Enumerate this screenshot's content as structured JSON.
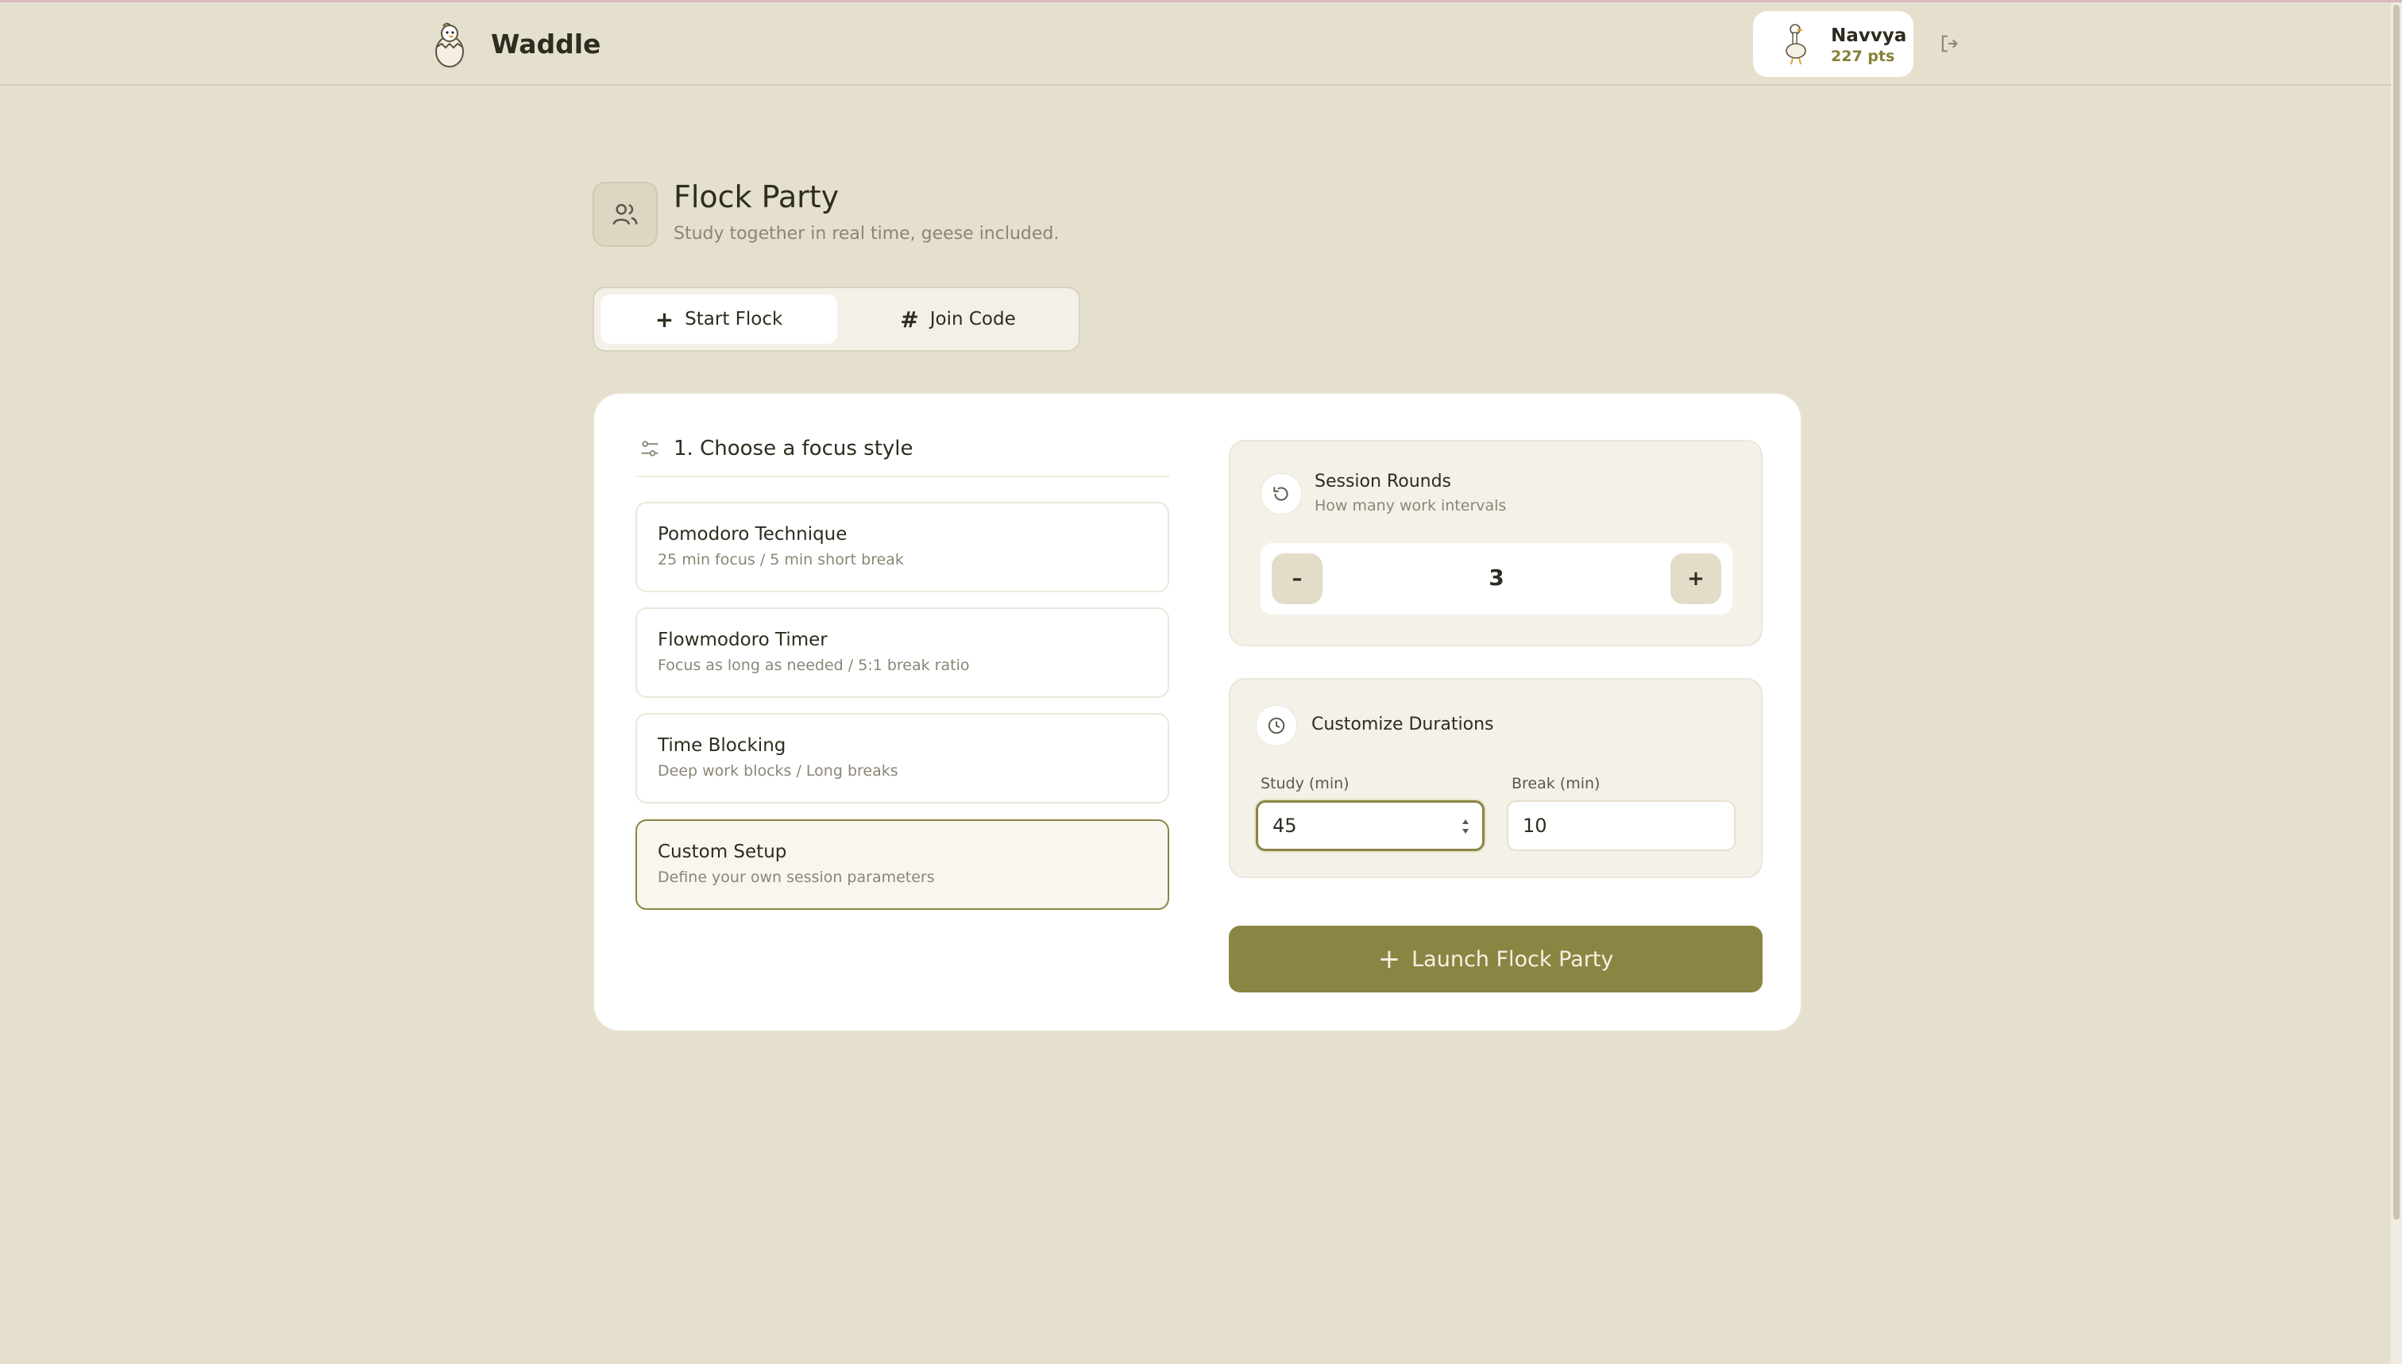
{
  "app": {
    "name": "Waddle"
  },
  "user": {
    "name": "Navvya",
    "points": "227 pts"
  },
  "header": {
    "title": "Flock Party",
    "subtitle": "Study together in real time, geese included."
  },
  "tabs": [
    {
      "label": "Start Flock",
      "icon": "plus-icon",
      "active": true
    },
    {
      "label": "Join Code",
      "icon": "hash-icon",
      "active": false
    }
  ],
  "focus_section": {
    "title": "1. Choose a focus style",
    "styles": [
      {
        "name": "Pomodoro Technique",
        "desc": "25 min focus / 5 min short break",
        "selected": false
      },
      {
        "name": "Flowmodoro Timer",
        "desc": "Focus as long as needed / 5:1 break ratio",
        "selected": false
      },
      {
        "name": "Time Blocking",
        "desc": "Deep work blocks / Long breaks",
        "selected": false
      },
      {
        "name": "Custom Setup",
        "desc": "Define your own session parameters",
        "selected": true
      }
    ]
  },
  "rounds": {
    "title": "Session Rounds",
    "subtitle": "How many work intervals",
    "minus": "–",
    "plus": "+",
    "value": "3"
  },
  "durations": {
    "title": "Customize Durations",
    "study_label": "Study (min)",
    "study_value": "45",
    "break_label": "Break (min)",
    "break_value": "10"
  },
  "launch": {
    "label": "Launch Flock Party"
  },
  "colors": {
    "background": "#e5dfcd",
    "accent": "#8b8544",
    "panel": "#ffffff"
  }
}
